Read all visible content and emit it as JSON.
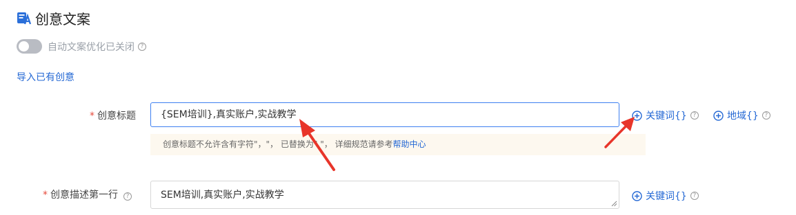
{
  "section": {
    "title": "创意文案",
    "icon": "creative-copy-icon"
  },
  "auto_optimize": {
    "label": "自动文案优化已关闭",
    "enabled": false,
    "help_icon": "?"
  },
  "import_link": "导入已有创意",
  "title_field": {
    "required_mark": "*",
    "label": "创意标题",
    "value": "{SEM培训},真实账户,实战教学",
    "hint_text": "创意标题不允许含有字符\"，\"，  已替换为\",\"，  详细规范请参考",
    "hint_link": "帮助中心",
    "keyword_button": "关键词{}",
    "region_button": "地域{}",
    "help_icon": "?"
  },
  "desc_field": {
    "required_mark": "*",
    "label": "创意描述第一行",
    "value": "SEM培训,真实账户,实战教学",
    "keyword_button": "关键词{}",
    "help_icon": "?"
  },
  "colors": {
    "accent": "#2468d4",
    "focus_border": "#3d7ff0",
    "required": "#e64a3b",
    "annotation_arrow": "#e8352a",
    "hint_bg": "#fdf8ef"
  }
}
